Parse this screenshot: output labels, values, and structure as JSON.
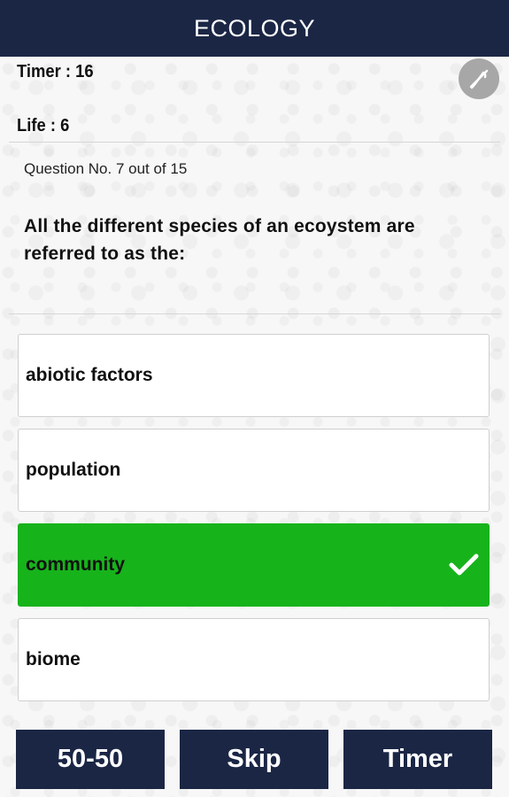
{
  "header": {
    "title": "ECOLOGY"
  },
  "stats": {
    "timer": "Timer  : 16",
    "life": "Life : 6"
  },
  "question": {
    "number_text": "Question No. 7 out of 15",
    "text": "All the different species of an ecoystem are referred to as the:"
  },
  "options": [
    {
      "label": "abiotic factors",
      "state": "default"
    },
    {
      "label": "population",
      "state": "default"
    },
    {
      "label": "community",
      "state": "correct"
    },
    {
      "label": "biome",
      "state": "default"
    }
  ],
  "lifelines": [
    {
      "label": "50-50"
    },
    {
      "label": "Skip"
    },
    {
      "label": "Timer"
    }
  ],
  "icons": {
    "mute": "sound-off-icon",
    "correct": "checkmark-icon"
  },
  "colors": {
    "header": "#1b2645",
    "correct": "#17b31b",
    "button": "#1b2645"
  }
}
